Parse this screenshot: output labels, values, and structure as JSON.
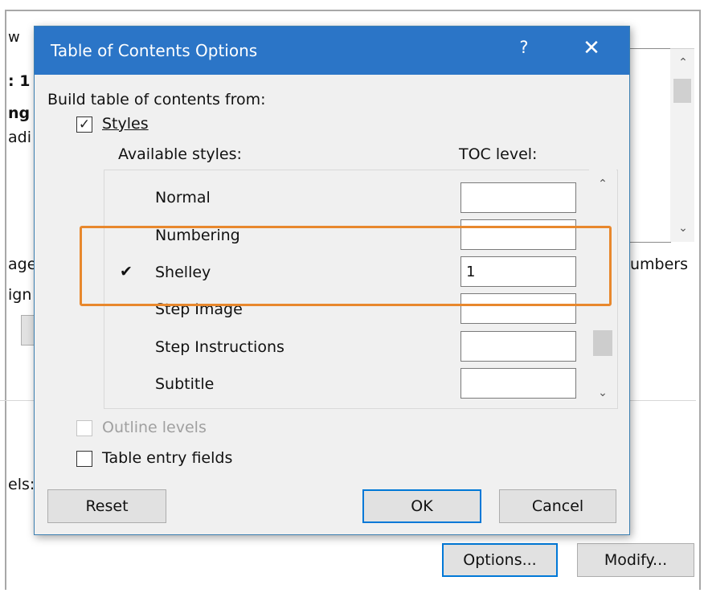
{
  "background": {
    "title_fragment": "w",
    "left_fragments": [
      ": 1",
      "ng",
      "adi",
      "age",
      "ign",
      "els:"
    ],
    "numbers_label": "umbers",
    "options_label": "Options...",
    "modify_label": "Modify..."
  },
  "dialog": {
    "title": "Table of Contents Options",
    "help": "?",
    "close": "✕",
    "build_label": "Build table of contents from:",
    "styles_label": "Styles",
    "styles_checked": true,
    "available_styles_label": "Available styles:",
    "toc_level_label": "TOC level:",
    "styles": [
      {
        "name": "Normal",
        "level": "",
        "checked": false
      },
      {
        "name": "Numbering",
        "level": "",
        "checked": false
      },
      {
        "name": "Shelley",
        "level": "1",
        "checked": true
      },
      {
        "name": "Step Image",
        "level": "",
        "checked": false
      },
      {
        "name": "Step Instructions",
        "level": "",
        "checked": false
      },
      {
        "name": "Subtitle",
        "level": "",
        "checked": false
      }
    ],
    "outline_levels_label": "Outline levels",
    "table_entry_label": "Table entry fields",
    "reset_label": "Reset",
    "ok_label": "OK",
    "cancel_label": "Cancel",
    "accent_color": "#2b75c7",
    "highlight_color": "#e8882d"
  }
}
